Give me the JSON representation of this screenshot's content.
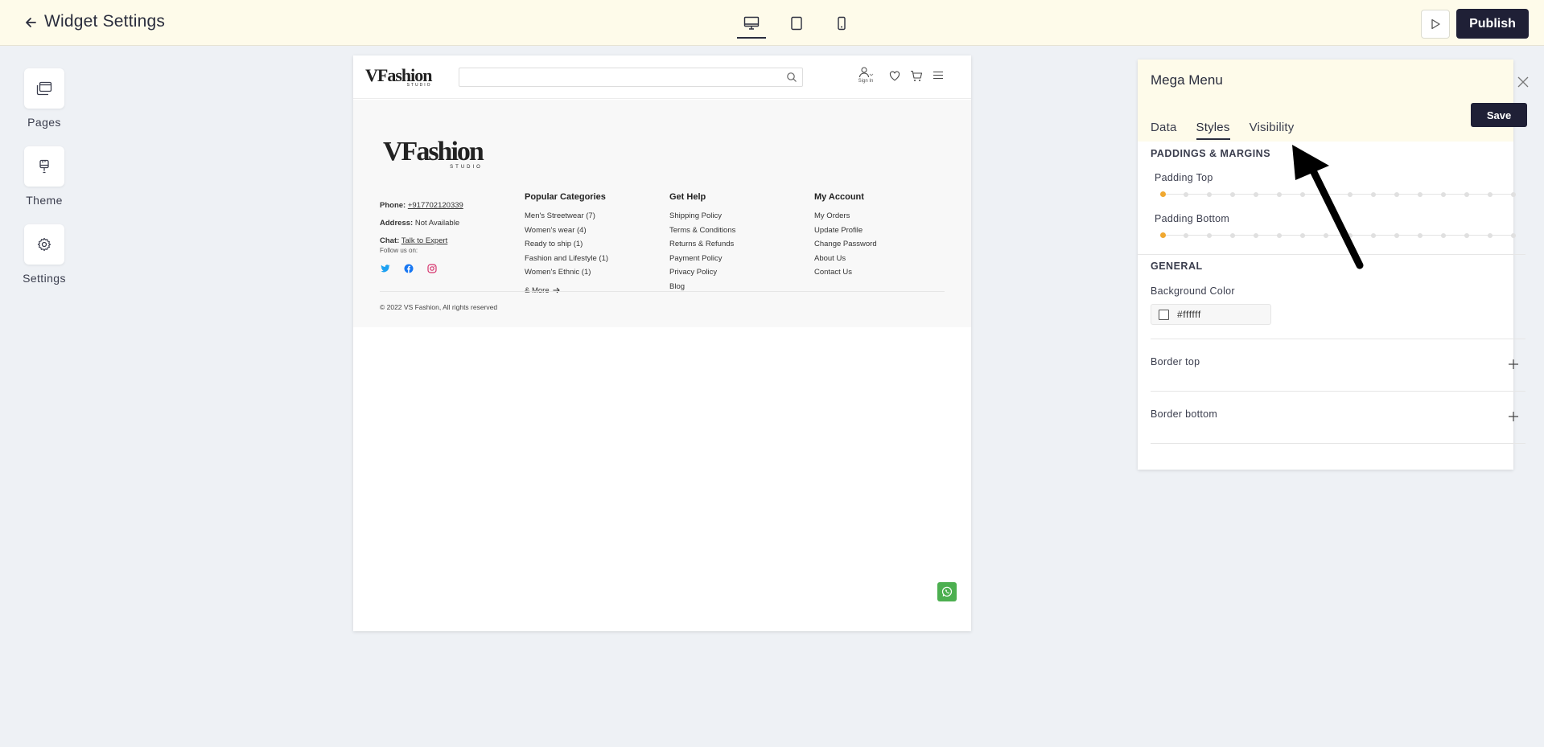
{
  "topbar": {
    "title": "Widget Settings",
    "publish_label": "Publish",
    "devices": [
      "desktop",
      "tablet",
      "mobile"
    ],
    "active_device": "desktop"
  },
  "rail": {
    "items": [
      {
        "label": "Pages",
        "icon": "pages-icon"
      },
      {
        "label": "Theme",
        "icon": "brush-icon"
      },
      {
        "label": "Settings",
        "icon": "gear-icon"
      }
    ]
  },
  "site": {
    "logo_text": "VFashion",
    "logo_sub": "STUDIO",
    "signin_label": "Sign In",
    "phone_label": "Phone:",
    "phone_value": "+917702120339",
    "address_label": "Address:",
    "address_value": "Not Available",
    "chat_label": "Chat:",
    "chat_value": "Talk to Expert",
    "follow_label": "Follow us on:",
    "columns": [
      {
        "title": "Popular Categories",
        "items": [
          "Men's Streetwear (7)",
          "Women's wear (4)",
          "Ready to ship (1)",
          "Fashion and Lifestyle (1)",
          "Women's Ethnic (1)"
        ],
        "more": "& More"
      },
      {
        "title": "Get Help",
        "items": [
          "Shipping Policy",
          "Terms & Conditions",
          "Returns & Refunds",
          "Payment Policy",
          "Privacy Policy",
          "Blog"
        ]
      },
      {
        "title": "My Account",
        "items": [
          "My Orders",
          "Update Profile",
          "Change Password",
          "About Us",
          "Contact Us"
        ]
      }
    ],
    "copyright": "© 2022 VS Fashion, All rights reserved"
  },
  "panel": {
    "title": "Mega Menu",
    "save_label": "Save",
    "tabs": [
      "Data",
      "Styles",
      "Visibility"
    ],
    "active_tab": "Styles",
    "paddings_section": "PADDINGS & MARGINS",
    "padding_top_label": "Padding Top",
    "padding_top_value": 0,
    "padding_bottom_label": "Padding Bottom",
    "padding_bottom_value": 0,
    "general_section": "GENERAL",
    "bg_color_label": "Background Color",
    "bg_color_value": "#ffffff",
    "border_top_label": "Border top",
    "border_bottom_label": "Border bottom"
  },
  "colors": {
    "topbar_bg": "#fefbea",
    "accent_dark": "#1f2036",
    "slider_active": "#f0a830",
    "whatsapp_green": "#4caf50"
  }
}
